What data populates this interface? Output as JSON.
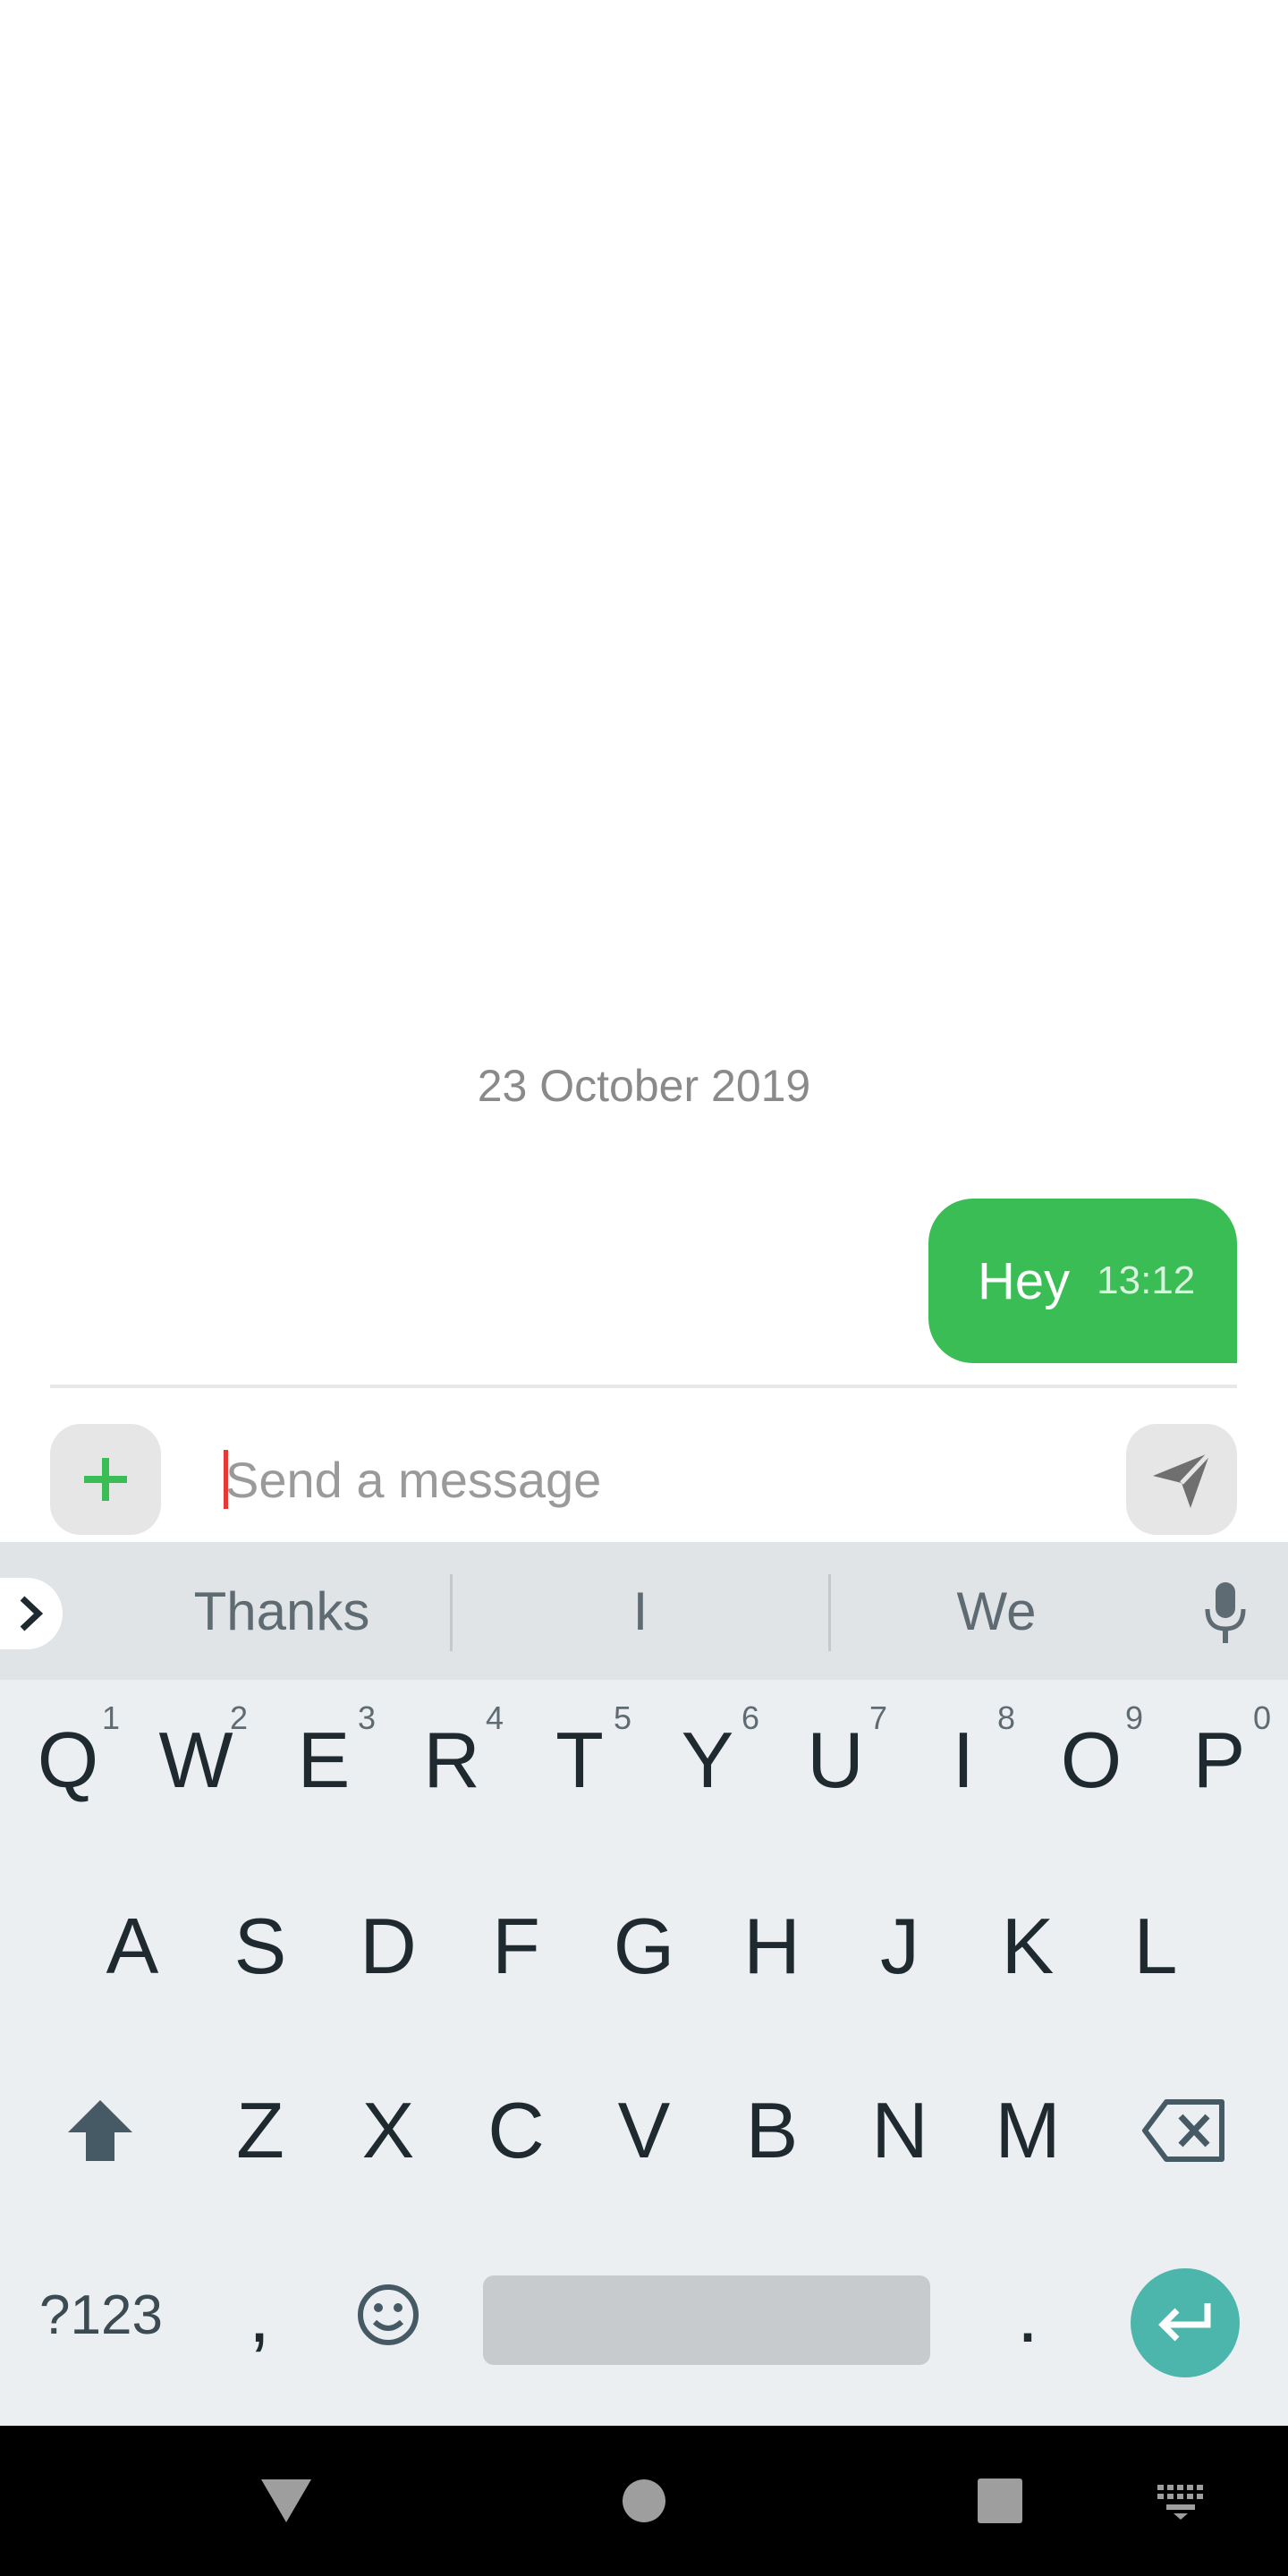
{
  "conversation": {
    "date_separator": "23 October 2019",
    "messages": [
      {
        "text": "Hey",
        "time": "13:12",
        "direction": "outgoing"
      }
    ],
    "bubble_color": "#3bbd55"
  },
  "composer": {
    "placeholder": "Send a message",
    "attach_icon": "plus-icon",
    "send_icon": "send-icon"
  },
  "keyboard": {
    "suggestions": [
      "Thanks",
      "I",
      "We"
    ],
    "row1": [
      {
        "label": "Q",
        "hint": "1"
      },
      {
        "label": "W",
        "hint": "2"
      },
      {
        "label": "E",
        "hint": "3"
      },
      {
        "label": "R",
        "hint": "4"
      },
      {
        "label": "T",
        "hint": "5"
      },
      {
        "label": "Y",
        "hint": "6"
      },
      {
        "label": "U",
        "hint": "7"
      },
      {
        "label": "I",
        "hint": "8"
      },
      {
        "label": "O",
        "hint": "9"
      },
      {
        "label": "P",
        "hint": "0"
      }
    ],
    "row2": [
      "A",
      "S",
      "D",
      "F",
      "G",
      "H",
      "J",
      "K",
      "L"
    ],
    "row3": [
      "Z",
      "X",
      "C",
      "V",
      "B",
      "N",
      "M"
    ],
    "symbols_label": "?123",
    "comma_label": ",",
    "period_label": ".",
    "accent_color": "#4db6ac"
  },
  "navigation": {
    "buttons": [
      "back-icon",
      "home-icon",
      "recents-icon",
      "keyboard-switch-icon"
    ]
  }
}
